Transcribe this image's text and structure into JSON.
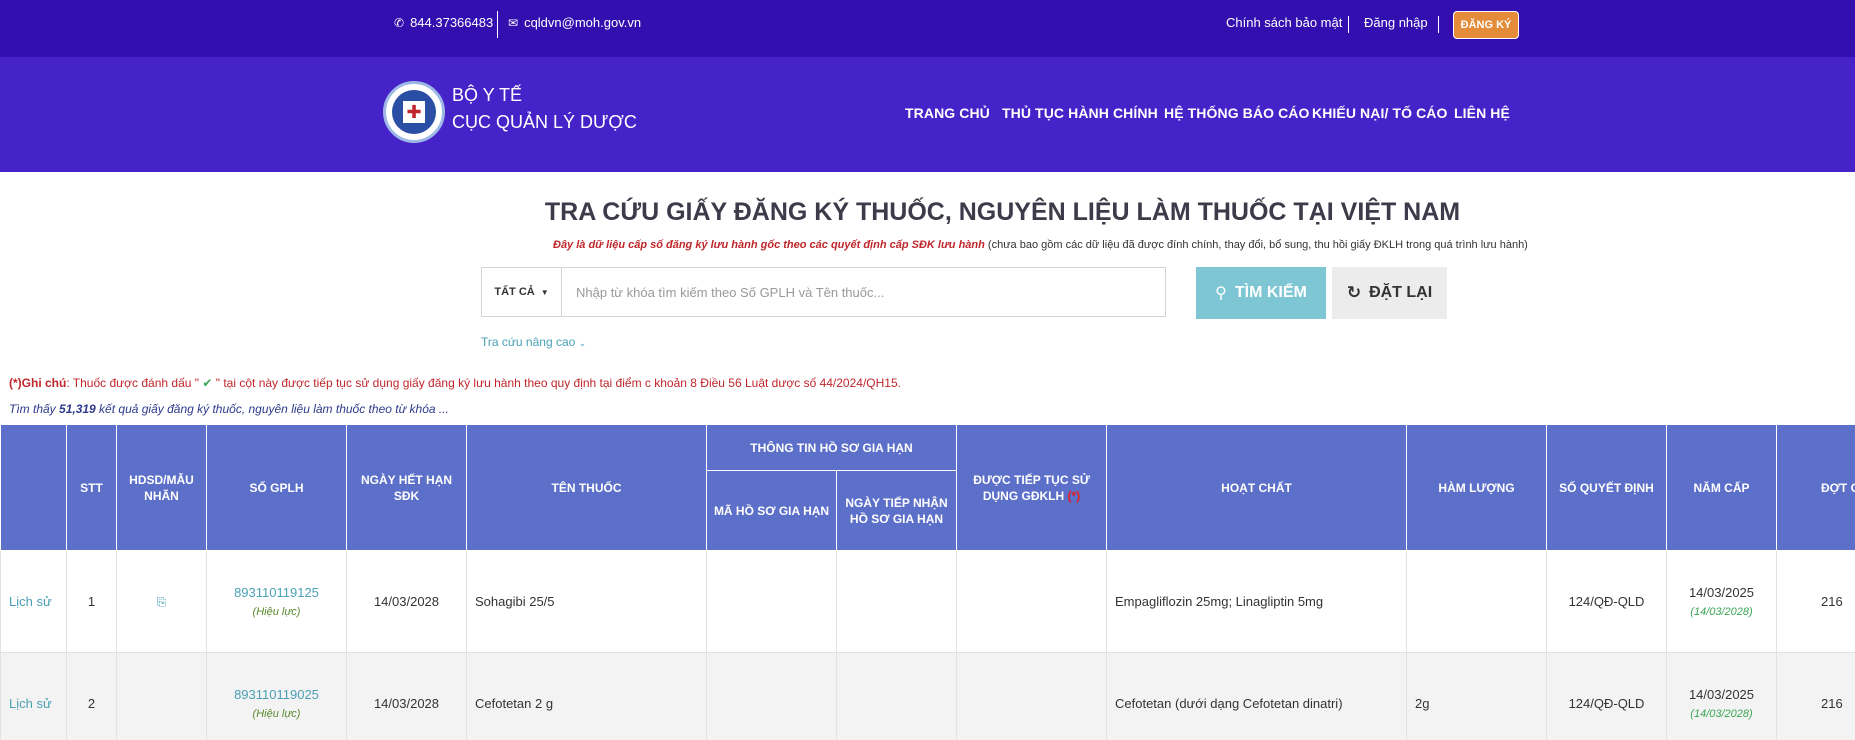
{
  "topbar": {
    "phone": "844.37366483",
    "email": "cqldvn@moh.gov.vn",
    "privacy": "Chính sách bảo mật",
    "login": "Đăng nhập",
    "register": "ĐĂNG KÝ"
  },
  "header": {
    "org_line1": "BỘ Y TẾ",
    "org_line2": "CỤC QUẢN LÝ DƯỢC",
    "nav": [
      "TRANG CHỦ",
      "THỦ TỤC HÀNH CHÍNH",
      "HỆ THỐNG BÁO CÁO",
      "KHIẾU NẠI/ TỐ CÁO",
      "LIÊN HỆ"
    ]
  },
  "search": {
    "title": "TRA CỨU GIẤY ĐĂNG KÝ THUỐC, NGUYÊN LIỆU LÀM THUỐC TẠI VIỆT NAM",
    "subtitle_red": "Đây là dữ liệu cấp số đăng ký lưu hành gốc theo các quyết định cấp SĐK lưu hành",
    "subtitle_rest": " (chưa bao gồm các dữ liệu đã được đính chính, thay đổi, bổ sung, thu hồi giấy ĐKLH trong quá trình lưu hành)",
    "type": "TẤT CẢ",
    "placeholder": "Nhập từ khóa tìm kiếm theo Số GPLH và Tên thuốc...",
    "search_btn": "TÌM KIẾM",
    "reset_btn": "ĐẶT LẠI",
    "advanced": "Tra cứu nâng cao"
  },
  "note": {
    "label": "(*)Ghi chú",
    "text_before": ": Thuốc được đánh dấu \" ",
    "text_after": " \" tại cột này được tiếp tục sử dụng giấy đăng ký lưu hành theo quy định tại điểm c khoản 8 Điều 56 Luật dược số 44/2024/QH15."
  },
  "found": {
    "prefix": "Tìm thấy ",
    "count": "51,319",
    "suffix": " kết quả giấy đăng ký thuốc, nguyên liệu làm thuốc theo từ khóa ..."
  },
  "table": {
    "headers": {
      "stt": "STT",
      "hdsd": "HDSD/MẪU NHÃN",
      "gplh": "SỐ GPLH",
      "expiry": "NGÀY HẾT HẠN SĐK",
      "name": "TÊN THUỐC",
      "renewal_group": "THÔNG TIN HỒ SƠ GIA HẠN",
      "renewal_code": "MÃ HỒ SƠ GIA HẠN",
      "renewal_date": "NGÀY TIẾP NHẬN HỒ SƠ GIA HẠN",
      "continued": "ĐƯỢC TIẾP TỤC SỬ DỤNG GĐKLH",
      "continued_mark": "(*)",
      "ingredient": "HOẠT CHẤT",
      "strength": "HÀM LƯỢNG",
      "decision": "SỐ QUYẾT ĐỊNH",
      "year": "NĂM CẤP",
      "batch": "ĐỢT C"
    },
    "rows": [
      {
        "history": "Lịch sử",
        "stt": "1",
        "gplh": "893110119125",
        "status": "(Hiệu lực)",
        "expiry": "14/03/2028",
        "name": "Sohagibi 25/5",
        "ingredient": "Empagliflozin 25mg; Linagliptin 5mg",
        "strength": "",
        "decision": "124/QĐ-QLD",
        "issue_date": "14/03/2025",
        "issue_valid": "(14/03/2028)",
        "batch": "216"
      },
      {
        "history": "Lịch sử",
        "stt": "2",
        "gplh": "893110119025",
        "status": "(Hiệu lực)",
        "expiry": "14/03/2028",
        "name": "Cefotetan 2 g",
        "ingredient": "Cefotetan (dưới dạng Cefotetan dinatri)",
        "strength": "2g",
        "decision": "124/QĐ-QLD",
        "issue_date": "14/03/2025",
        "issue_valid": "(14/03/2028)",
        "batch": "216"
      }
    ]
  }
}
